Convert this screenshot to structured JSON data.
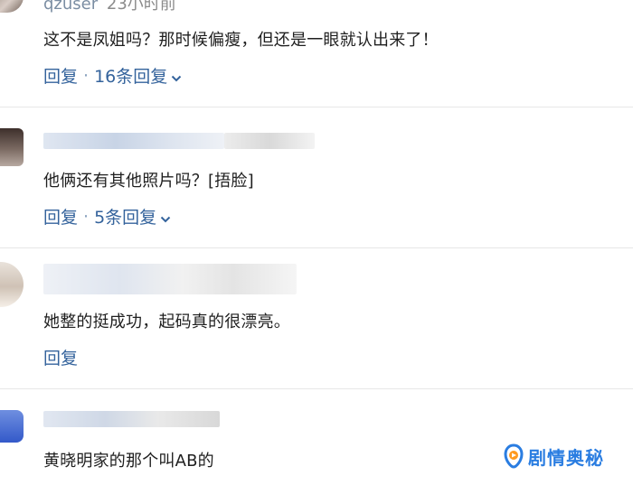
{
  "comments": [
    {
      "username": "qzuser",
      "time": "23小时前",
      "text": "这不是凤姐吗？那时候偏瘦，但还是一眼就认出来了！",
      "reply_label": "回复",
      "separator": "·",
      "replies_label": "16条回复"
    },
    {
      "text": "他俩还有其他照片吗？[捂脸]",
      "reply_label": "回复",
      "separator": "·",
      "replies_label": "5条回复"
    },
    {
      "text": "她整的挺成功，起码真的很漂亮。",
      "reply_label": "回复"
    },
    {
      "text": "黄晓明家的那个叫AB的"
    }
  ],
  "watermark": {
    "text": "剧情奥秘",
    "color": "#2a7de1"
  }
}
